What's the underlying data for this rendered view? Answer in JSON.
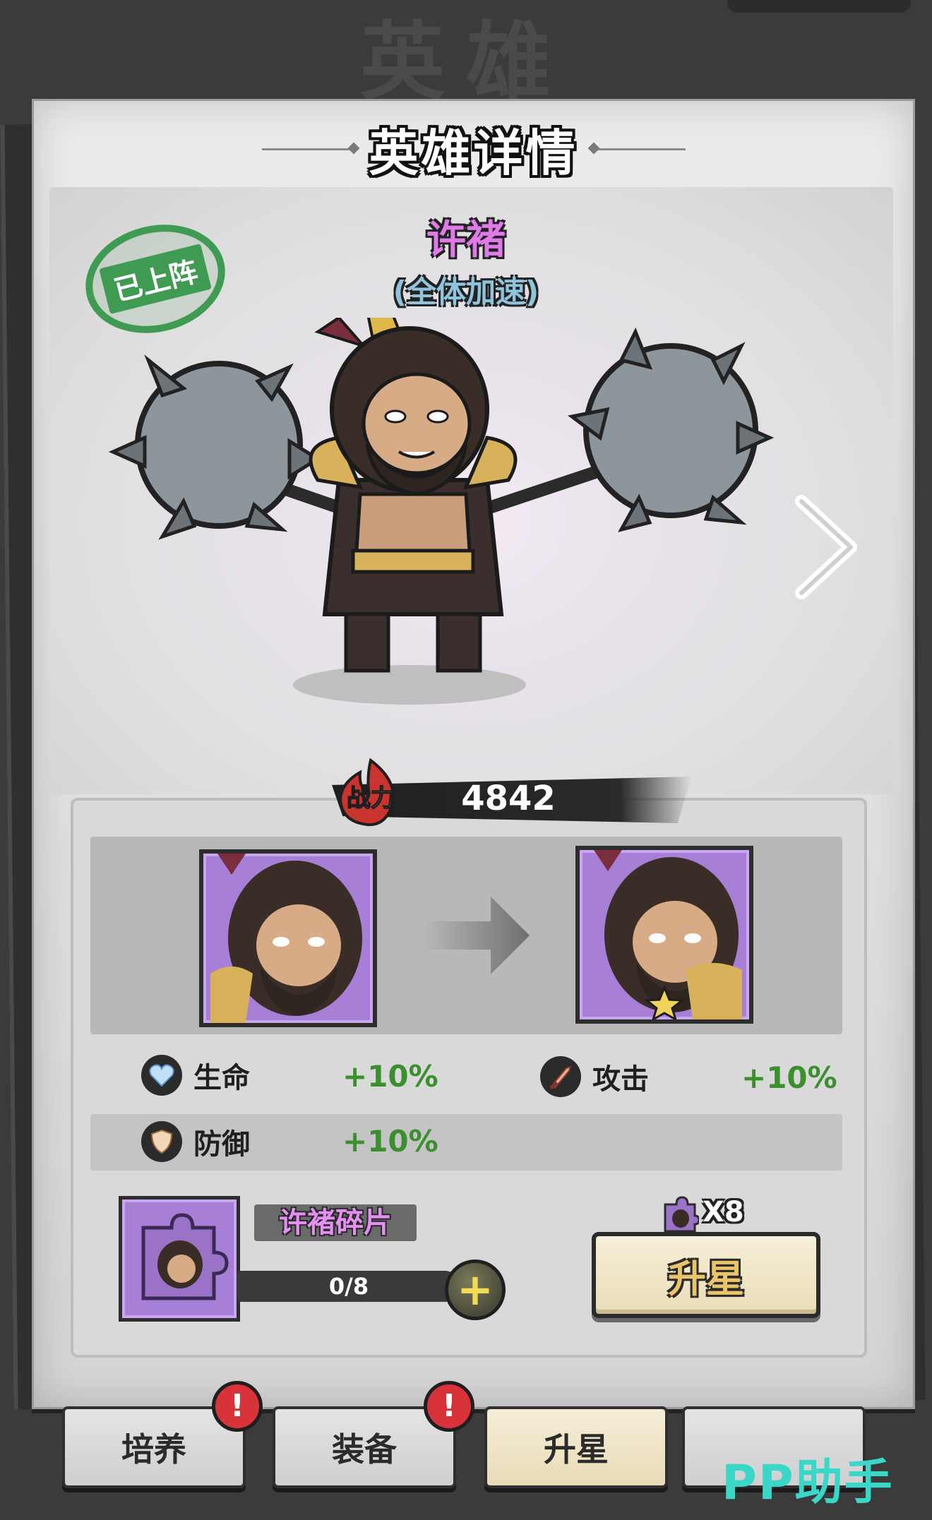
{
  "background_title": "英雄",
  "card": {
    "title": "英雄详情"
  },
  "hero": {
    "status_seal": "已上阵",
    "name": "许褚",
    "skill": "(全体加速)",
    "power_label": "战力",
    "power": "4842"
  },
  "stats": [
    {
      "icon": "heart-icon",
      "label": "生命",
      "bonus": "+10%"
    },
    {
      "icon": "sword-icon",
      "label": "攻击",
      "bonus": "+10%"
    },
    {
      "icon": "shield-icon",
      "label": "防御",
      "bonus": "+10%"
    }
  ],
  "shard": {
    "name": "许褚碎片",
    "progress_text": "0/8",
    "progress_fraction": 0.0,
    "cost": "X8"
  },
  "upgrade_button": "升星",
  "tabs": [
    {
      "label": "培养",
      "alert": "!"
    },
    {
      "label": "装备",
      "alert": "!"
    },
    {
      "label": "升星"
    },
    {
      "label": ""
    }
  ],
  "watermark": "PP助手",
  "colors": {
    "name_pink": "#e07ae8",
    "skill_blue": "#8fc4dc",
    "bonus_green": "#3c8f2e",
    "portrait_purple": "#a77fd6",
    "alert_red": "#d9333a",
    "seal_green": "#3f9a52"
  }
}
